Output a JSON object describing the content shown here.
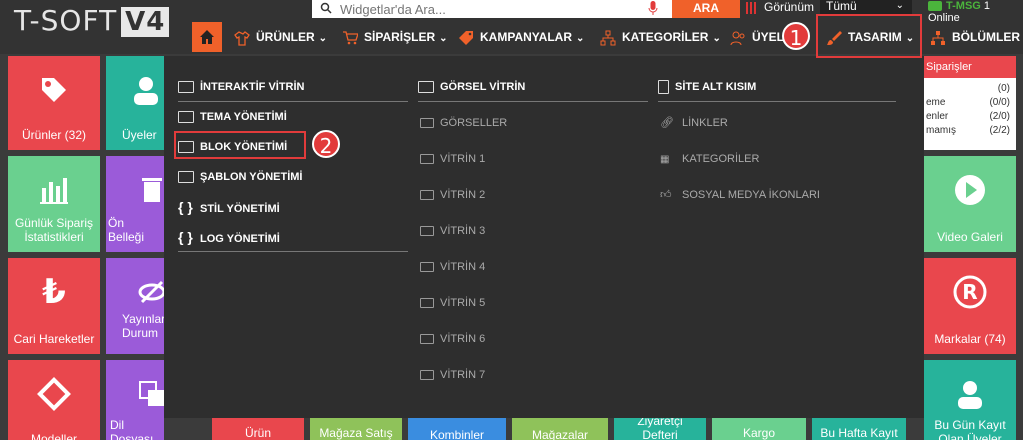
{
  "header": {
    "logo_text": "T-SOFT",
    "logo_version": "V4",
    "search": {
      "placeholder": "Widgetlar'da Ara..."
    },
    "search_button": "ARA",
    "view_label": "Görünüm",
    "view_select": "Tümü",
    "tmsg_brand": "T-MSG",
    "tmsg_status": "1 Online"
  },
  "nav": {
    "items": [
      {
        "label": "ÜRÜNLER"
      },
      {
        "label": "SİPARİŞLER"
      },
      {
        "label": "KAMPANYALAR"
      },
      {
        "label": "KATEGORİLER"
      },
      {
        "label": "ÜYELER"
      },
      {
        "label": "TASARIM"
      },
      {
        "label": "BÖLÜMLER"
      }
    ]
  },
  "annotations": {
    "one": "1",
    "two": "2"
  },
  "mega_menu": {
    "col1": [
      {
        "label": "İNTERAKTİF VİTRİN"
      },
      {
        "label": "TEMA YÖNETİMİ"
      },
      {
        "label": "BLOK YÖNETİMİ"
      },
      {
        "label": "ŞABLON YÖNETİMİ"
      },
      {
        "label": "STİL YÖNETİMİ"
      },
      {
        "label": "LOG YÖNETİMİ"
      }
    ],
    "col2_head": "GÖRSEL VİTRİN",
    "col2": [
      "GÖRSELLER",
      "VİTRİN 1",
      "VİTRİN 2",
      "VİTRİN 3",
      "VİTRİN 4",
      "VİTRİN 5",
      "VİTRİN 6",
      "VİTRİN 7"
    ],
    "col3_head": "SİTE ALT KISIM",
    "col3": [
      "LİNKLER",
      "KATEGORİLER",
      "SOSYAL MEDYA İKONLARI"
    ]
  },
  "tiles": {
    "urunler": "Ürünler (32)",
    "uyeler": "Üyeler",
    "gunluk": "Günlük Sipariş İstatistikleri",
    "onbellek": "Ön Belleği",
    "cari": "Cari Hareketler",
    "yayinlar": "Yayınlar Durum",
    "modeller": "Modeller",
    "dil": "Dil Dosyası",
    "urun_kis": "Ürün Kişiselleştirme",
    "magaza_satis": "Mağaza Satış Kayıtları",
    "kombinler": "Kombinler",
    "magazalar": "Mağazalar",
    "ziyaretci": "Ziyaretçi Defteri",
    "kargo": "Kargo Entegrasyonu",
    "bu_hafta": "Bu Hafta Kayıt Olan Üyeler",
    "video": "Video Galeri",
    "markalar": "Markalar (74)",
    "bu_gun": "Bu Gün Kayıt Olan Üyeler"
  },
  "orders_panel": {
    "title": "Siparişler",
    "rows": [
      {
        "label": "",
        "value": "(0)"
      },
      {
        "label": "eme",
        "value": "(0/0)"
      },
      {
        "label": "enler",
        "value": "(2/0)"
      },
      {
        "label": "mamış",
        "value": "(2/2)"
      }
    ]
  },
  "colors": {
    "accent": "#f0612a",
    "annotation": "#e23b3b",
    "tile_red": "#e9474d",
    "tile_teal": "#27b39b",
    "tile_green": "#6ad08f",
    "tile_purple": "#9b5bd9",
    "tile_olive": "#8fc25a",
    "tile_blue": "#3a8de0"
  }
}
